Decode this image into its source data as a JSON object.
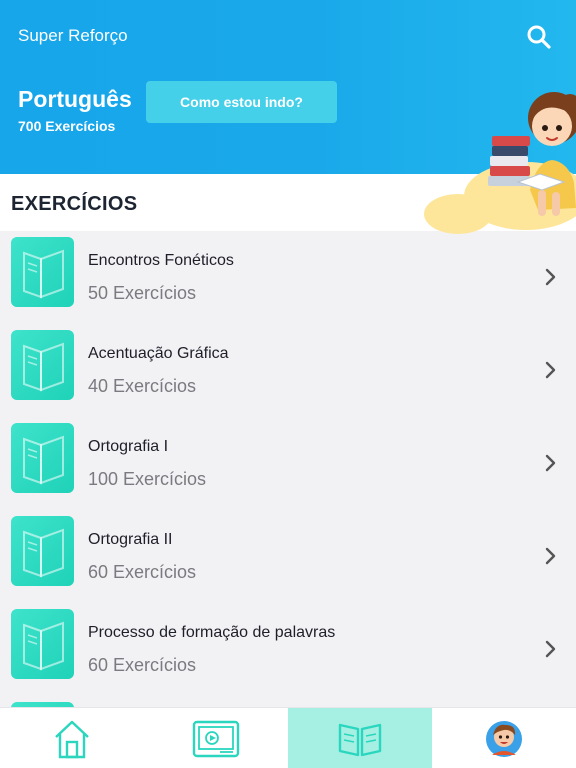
{
  "header": {
    "app_title": "Super Reforço",
    "subject": "Português",
    "subject_count": "700 Exercícios",
    "progress_button": "Como estou indo?",
    "search_icon": "search-icon"
  },
  "section": {
    "title": "EXERCÍCIOS"
  },
  "exercises": [
    {
      "title": "Encontros Fonéticos",
      "count": "50 Exercícios"
    },
    {
      "title": "Acentuação Gráfica",
      "count": "40 Exercícios"
    },
    {
      "title": "Ortografia I",
      "count": "100 Exercícios"
    },
    {
      "title": "Ortografia II",
      "count": "60 Exercícios"
    },
    {
      "title": "Processo de formação de palavras",
      "count": "60 Exercícios"
    }
  ],
  "tabs": [
    {
      "icon": "home-icon",
      "active": false
    },
    {
      "icon": "video-icon",
      "active": false
    },
    {
      "icon": "book-icon",
      "active": true
    },
    {
      "icon": "avatar-icon",
      "active": false
    }
  ],
  "colors": {
    "header": "#1aa8ea",
    "accent": "#45d0ea",
    "teal": "#2ad6be",
    "active_tab": "#a5f0e3"
  }
}
